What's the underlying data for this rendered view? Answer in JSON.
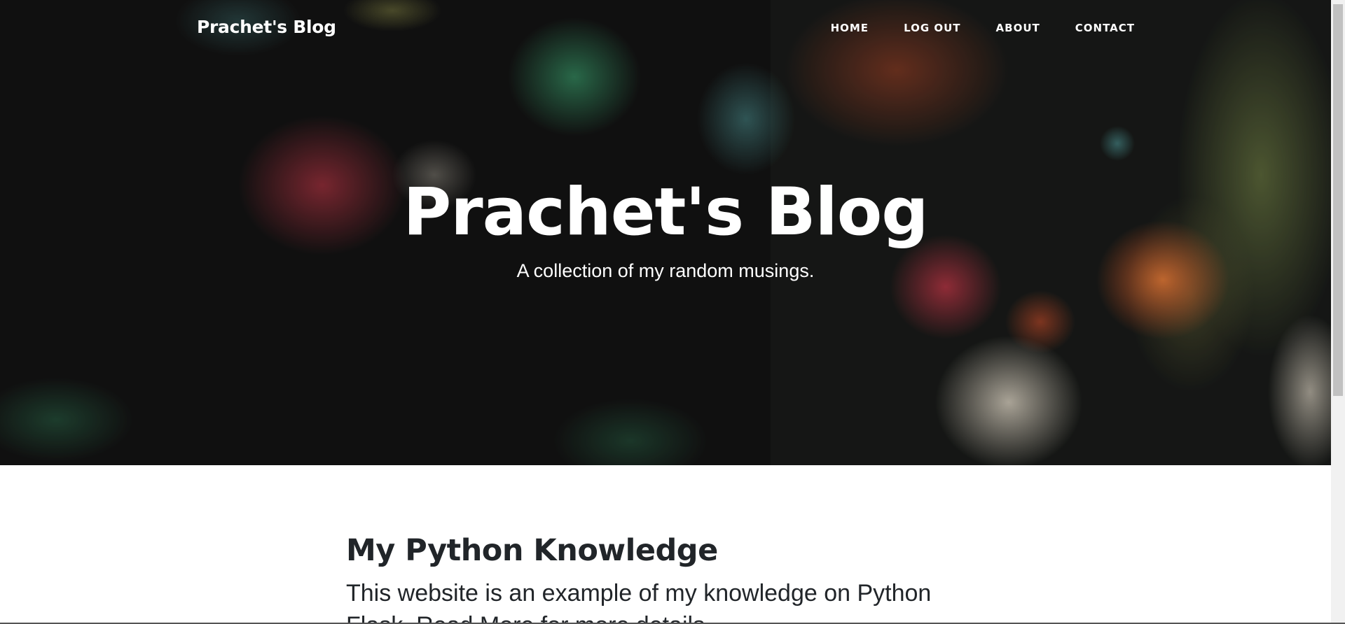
{
  "nav": {
    "brand": "Prachet's Blog",
    "links": [
      {
        "label": "HOME"
      },
      {
        "label": "LOG OUT"
      },
      {
        "label": "ABOUT"
      },
      {
        "label": "CONTACT"
      }
    ]
  },
  "masthead": {
    "title": "Prachet's Blog",
    "subheading": "A collection of my random musings."
  },
  "posts": [
    {
      "title": "My Python Knowledge",
      "subtitle": "This website is an example of my knowledge on Python Flask. Read More for more details."
    }
  ],
  "colors": {
    "hero_text": "#ffffff",
    "body_text": "#212529",
    "background": "#ffffff"
  }
}
